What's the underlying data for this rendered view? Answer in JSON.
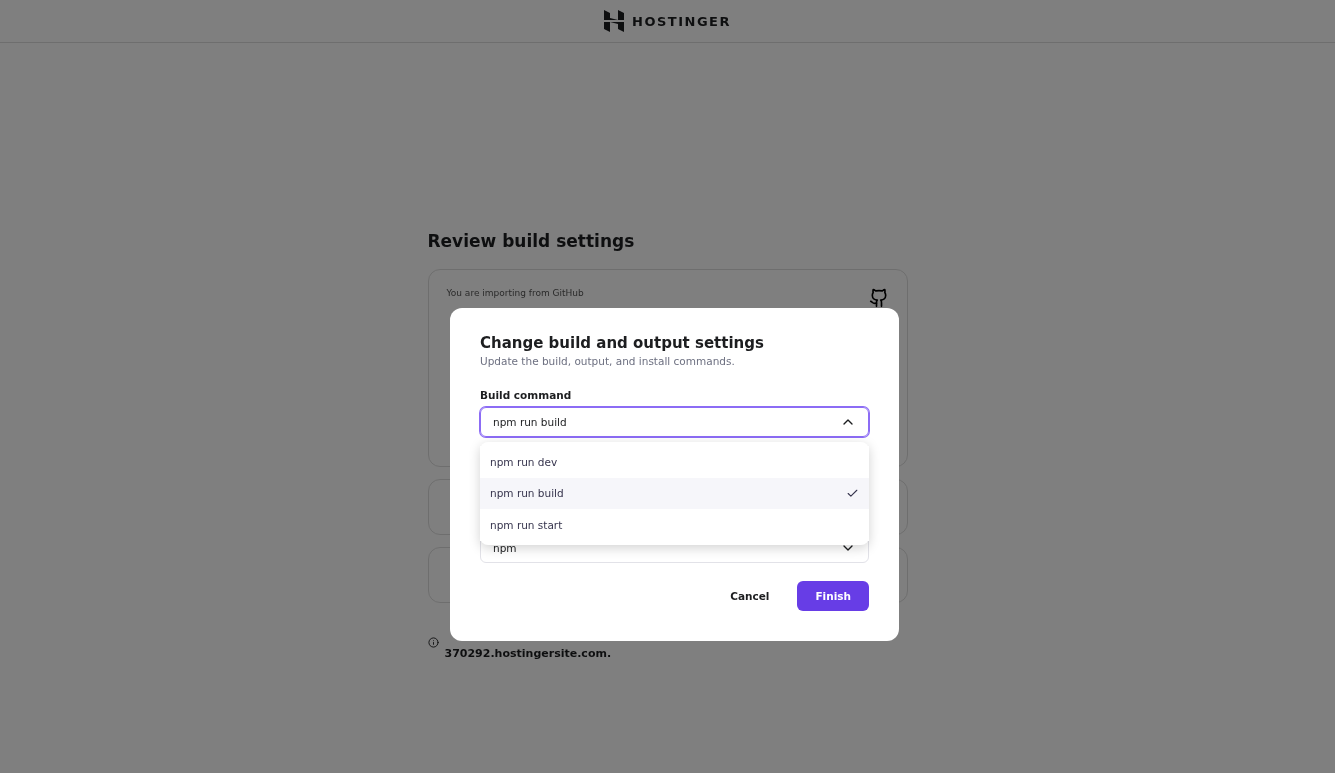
{
  "header": {
    "logo": "HOSTINGER"
  },
  "page": {
    "title": "Review build settings",
    "import_source": "You are importing from GitHub",
    "domain_note": "370292.hostingersite.com."
  },
  "dialog": {
    "title": "Change build and output settings",
    "subtitle": "Update the build, output, and install commands.",
    "build_command": {
      "label": "Build command",
      "value": "npm run build",
      "expanded": true,
      "options": [
        {
          "label": "npm run dev",
          "selected": false
        },
        {
          "label": "npm run build",
          "selected": true
        },
        {
          "label": "npm run start",
          "selected": false
        }
      ]
    },
    "package_manager": {
      "value": "npm",
      "expanded": false
    },
    "buttons": [
      {
        "label": "Cancel",
        "kind": "secondary"
      },
      {
        "label": "Finish",
        "kind": "primary"
      }
    ]
  }
}
